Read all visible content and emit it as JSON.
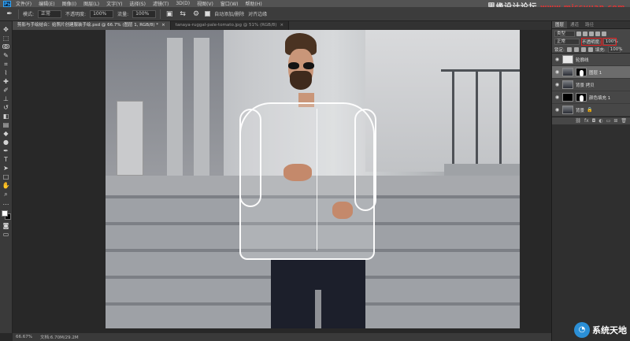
{
  "app": {
    "logo": "Ps",
    "menu": [
      "文件(F)",
      "编辑(E)",
      "图像(I)",
      "图层(L)",
      "文字(Y)",
      "选择(S)",
      "滤镜(T)",
      "3D(D)",
      "视图(V)",
      "窗口(W)",
      "帮助(H)"
    ],
    "watermark_top": "思缘设计论坛",
    "watermark_site": "www.missyuan.com"
  },
  "options_bar": {
    "mode_label": "模式:",
    "mode_value": "正常",
    "opacity_label": "不透明度:",
    "opacity_value": "100%",
    "flow_label": "流量:",
    "flow_value": "100%",
    "auto_add_label": "自动添加/删除",
    "align_label": "对齐边缘"
  },
  "tabs": [
    {
      "label": "剪影与手绘结合：给照片创建服装手绘.psd @ 66.7% (图层 1, RGB/8) *",
      "active": true
    },
    {
      "label": "tanaya-ruggal-pale-tomato.jpg @ 51% (RGB/8)",
      "active": false
    }
  ],
  "status_bar": {
    "zoom": "66.67%",
    "doc": "文档:6.70M/29.2M"
  },
  "layers_panel": {
    "tabs": [
      "图层",
      "通道",
      "路径"
    ],
    "filter_label": "类型",
    "blend_mode": "正常",
    "opacity_label": "不透明度:",
    "opacity_value": "100%",
    "lock_label": "锁定:",
    "fill_label": "填充:",
    "fill_value": "100%",
    "layers": [
      {
        "name": "轮廓线",
        "thumb": "white",
        "mask": false,
        "selected": false
      },
      {
        "name": "图层 1",
        "thumb": "photo",
        "mask": true,
        "selected": true
      },
      {
        "name": "背景 拷贝",
        "thumb": "photo",
        "mask": false,
        "selected": false
      },
      {
        "name": "颜色填充 1",
        "thumb": "black",
        "mask": true,
        "selected": false
      },
      {
        "name": "背景",
        "thumb": "photo",
        "mask": false,
        "selected": false
      }
    ]
  },
  "watermark_bottom": "系统天地",
  "icons": {
    "eye": "eye-icon",
    "lock": "lock-icon"
  }
}
